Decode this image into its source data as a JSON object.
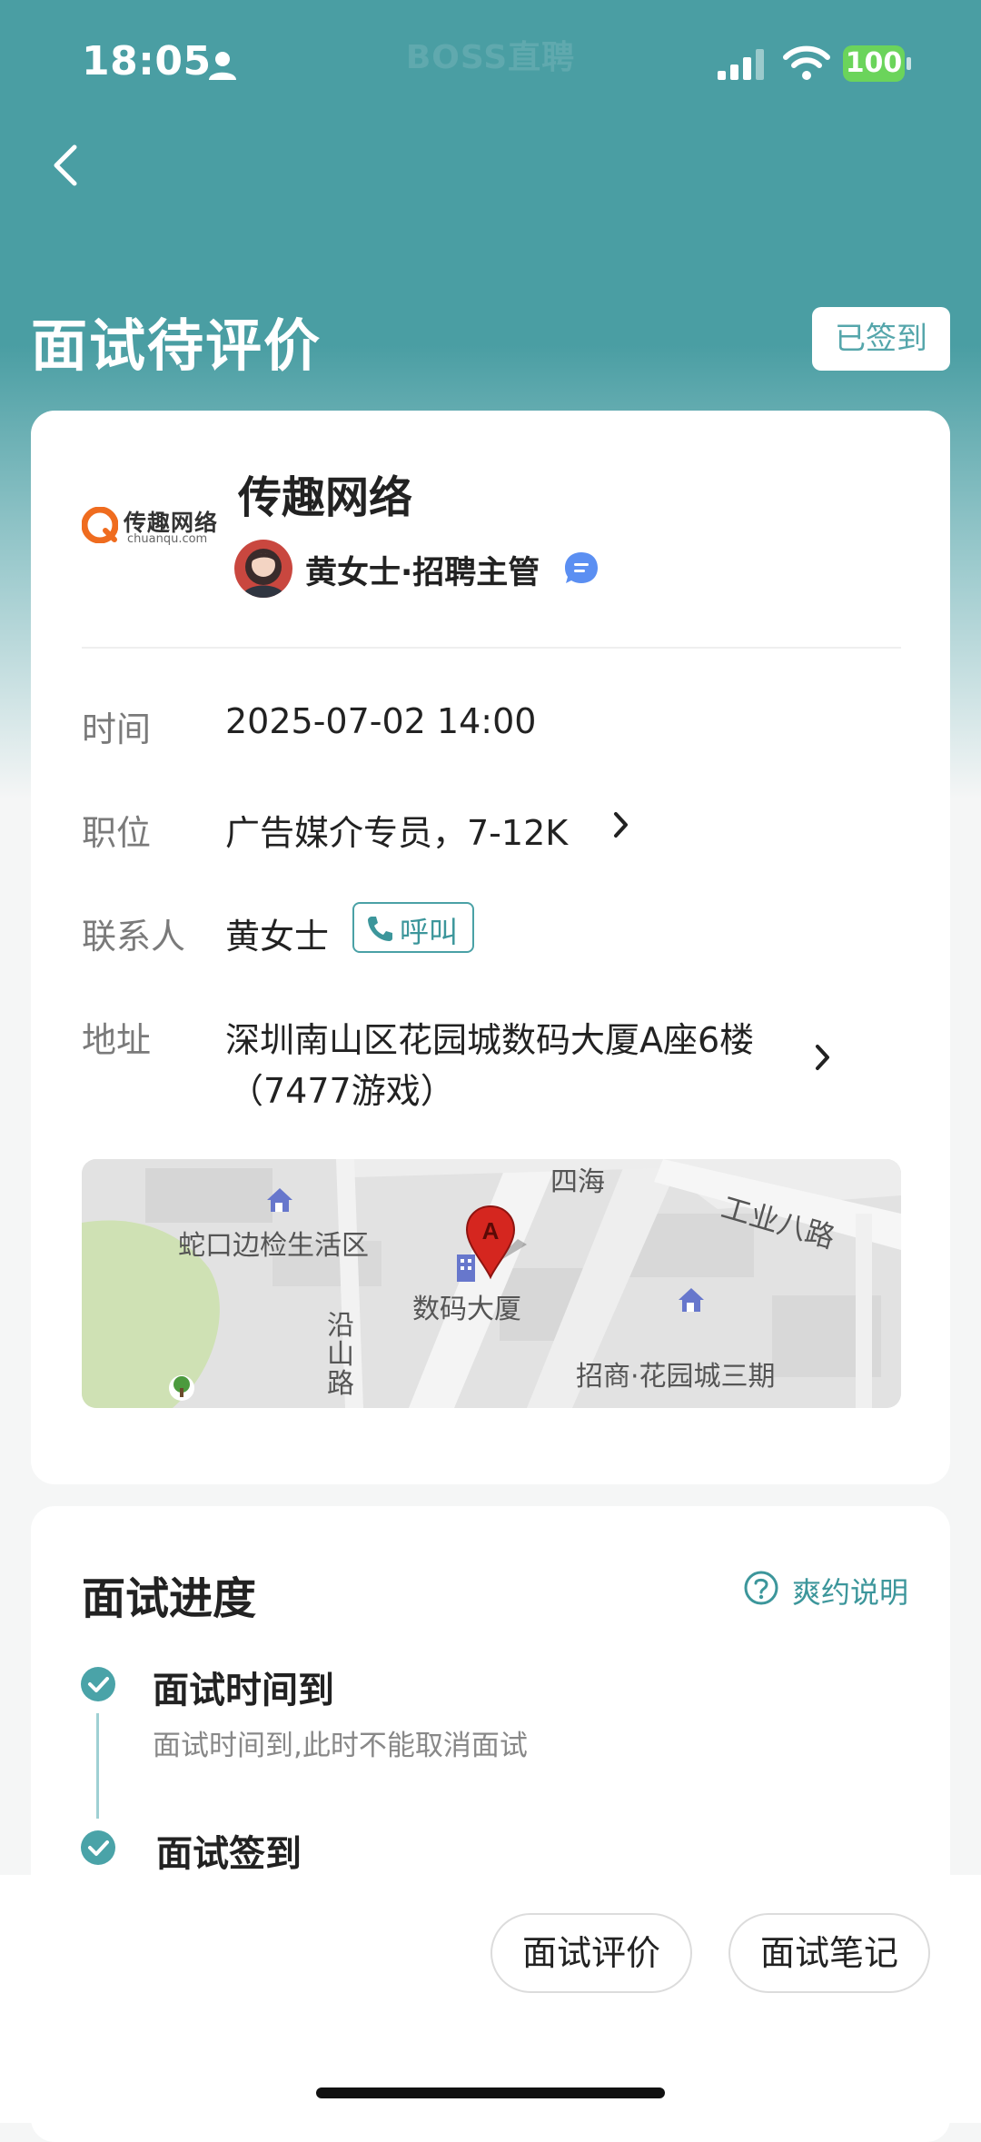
{
  "status_bar": {
    "time": "18:05",
    "watermark": "BOSS直聘",
    "battery": "100",
    "colors": {
      "battery": "#6bd45b"
    }
  },
  "header": {
    "title": "面试待评价",
    "signed_badge": "已签到",
    "back_icon": "chevron-left-icon"
  },
  "company": {
    "logo_text": "传趣网络",
    "logo_domain": "chuanqu.com",
    "name": "传趣网络",
    "recruiter": "黄女士·招聘主管"
  },
  "details": {
    "time_label": "时间",
    "time_value": "2025-07-02 14:00",
    "position_label": "职位",
    "position_value": "广告媒介专员，7-12K",
    "contact_label": "联系人",
    "contact_value": "黄女士",
    "call_label": "呼叫",
    "address_label": "地址",
    "address_line1": "深圳南山区花园城数码大厦A座6楼",
    "address_line2": "（7477游戏）"
  },
  "map": {
    "labels": {
      "sihai": "四海",
      "gongye": "工业八路",
      "shekou": "蛇口边检生活区",
      "shuma": "数码大厦",
      "yanshan": "沿山路",
      "zhaoshang": "招商·花园城三期"
    },
    "pin_letter": "A"
  },
  "progress": {
    "title": "面试进度",
    "rule_link": "爽约说明",
    "steps": [
      {
        "title": "面试时间到",
        "subtitle": "面试时间到,此时不能取消面试"
      },
      {
        "title": "面试签到"
      }
    ]
  },
  "actions": {
    "evaluate": "面试评价",
    "notes": "面试笔记"
  },
  "theme": {
    "accent": "#4a9ea3",
    "teal_text": "#3c969b"
  }
}
